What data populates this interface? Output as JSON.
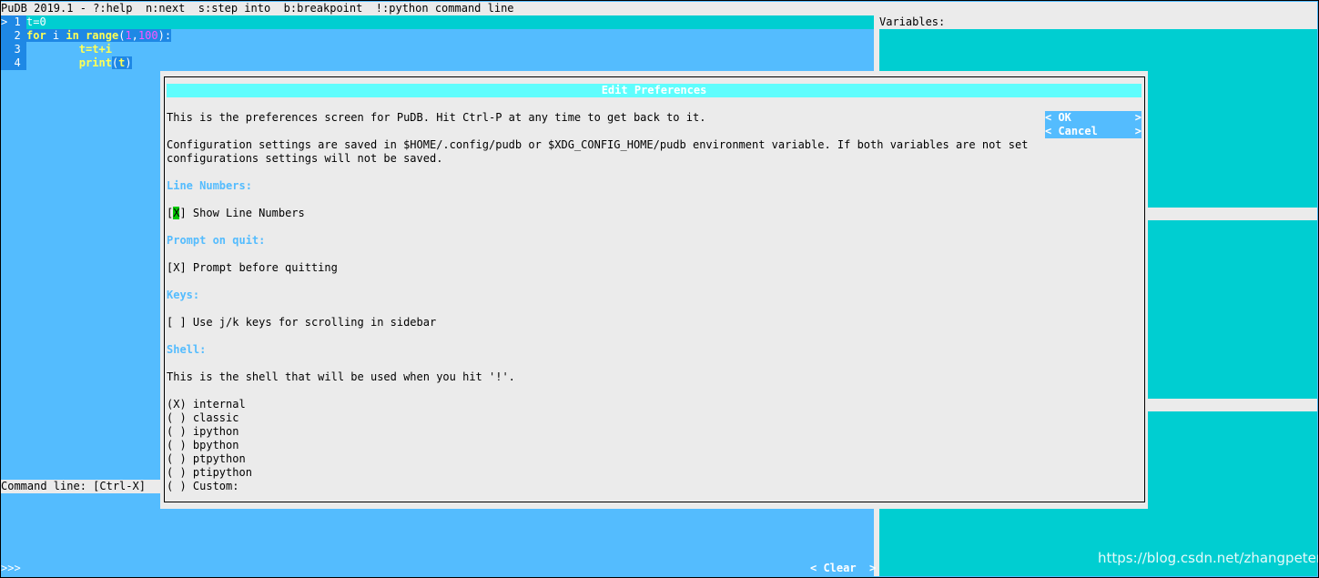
{
  "title_bar": "PuDB 2019.1 - ?:help  n:next  s:step into  b:breakpoint  !:python command line",
  "source": {
    "marker": ">",
    "lines": [
      {
        "no": "1",
        "text": "t=0"
      },
      {
        "no": "2",
        "kw1": "for",
        "v1": "i",
        "kw2": "in",
        "fn": "range",
        "p1": "(",
        "n1": "1",
        "comma": ",",
        "n2": "100",
        "p2": "):"
      },
      {
        "no": "3",
        "text": "        t=t+i"
      },
      {
        "no": "4",
        "fn": "print",
        "p1": "(",
        "arg": "t",
        "p2": ")"
      }
    ]
  },
  "variables_label": "Variables:",
  "command_line_label": "Command line: [Ctrl-X]",
  "prompt": ">>>",
  "clear_button": "< Clear  >",
  "dialog": {
    "title": "Edit Preferences",
    "intro": "This is the preferences screen for PuDB. Hit Ctrl-P at any time to get back to it.",
    "config_line1": "Configuration settings are saved in $HOME/.config/pudb or $XDG_CONFIG_HOME/pudb environment variable. If both variables are not set",
    "config_line2": "configurations settings will not be saved.",
    "ok_left": "< OK",
    "ok_right": ">",
    "cancel_left": "< Cancel",
    "cancel_right": ">",
    "sections": {
      "line_numbers": "Line Numbers:",
      "prompt_on_quit": "Prompt on quit:",
      "keys": "Keys:",
      "shell": "Shell:"
    },
    "show_line_numbers": {
      "open": "[",
      "mark": "X",
      "close": "]",
      "label": " Show Line Numbers"
    },
    "prompt_before_quit": "[X] Prompt before quitting",
    "jk_keys": "[ ] Use j/k keys for scrolling in sidebar",
    "shell_desc": "This is the shell that will be used when you hit '!'.",
    "shell_options": [
      "(X) internal",
      "( ) classic",
      "( ) ipython",
      "( ) bpython",
      "( ) ptpython",
      "( ) ptipython",
      "( ) Custom:"
    ]
  },
  "watermark": "https://blog.csdn.net/zhangpeterx",
  "colors": {
    "background": "#54bcfe",
    "panel": "#00ced1",
    "dialog_bg": "#ebebeb",
    "dialog_title_bg": "#5ffdfd",
    "focus": "#00c800"
  }
}
